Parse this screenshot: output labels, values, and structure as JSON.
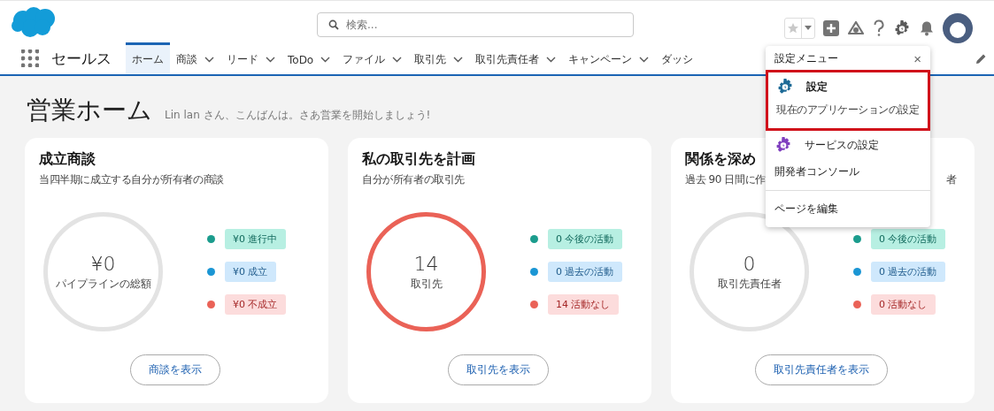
{
  "header": {
    "search": {
      "placeholder": "検索..."
    }
  },
  "nav": {
    "app_name": "セールス",
    "tabs": [
      {
        "label": "ホーム",
        "selected": true,
        "has_menu": false
      },
      {
        "label": "商談",
        "selected": false,
        "has_menu": true
      },
      {
        "label": "リード",
        "selected": false,
        "has_menu": true
      },
      {
        "label": "ToDo",
        "selected": false,
        "has_menu": true
      },
      {
        "label": "ファイル",
        "selected": false,
        "has_menu": true
      },
      {
        "label": "取引先",
        "selected": false,
        "has_menu": true
      },
      {
        "label": "取引先責任者",
        "selected": false,
        "has_menu": true
      },
      {
        "label": "キャンペーン",
        "selected": false,
        "has_menu": true
      },
      {
        "label": "ダッシ",
        "selected": false,
        "has_menu": false
      }
    ]
  },
  "page": {
    "title": "営業ホーム",
    "greeting": "Lin lan さん、こんばんは。さあ営業を開始しましょう!"
  },
  "cards": [
    {
      "title": "成立商談",
      "subtitle": [
        "当四半期に成立する自分が所有者の商談"
      ],
      "ring": {
        "value": "¥0",
        "label": "パイプラインの総額",
        "color": "#e3e3e3"
      },
      "legend": [
        {
          "label": "¥0 進行中",
          "color": "#1b9c8d"
        },
        {
          "label": "¥0 成立",
          "color": "#1b96d4"
        },
        {
          "label": "¥0 不成立",
          "color": "#ea6257"
        }
      ],
      "button": "商談を表示"
    },
    {
      "title": "私の取引先を計画",
      "subtitle": [
        "自分が所有者の取引先"
      ],
      "ring": {
        "value": "14",
        "label": "取引先",
        "color": "#ea6257"
      },
      "legend": [
        {
          "label": "0 今後の活動",
          "color": "#1b9c8d"
        },
        {
          "label": "0 過去の活動",
          "color": "#1b96d4"
        },
        {
          "label": "14 活動なし",
          "color": "#ea6257"
        }
      ],
      "button": "取引先を表示"
    },
    {
      "title": "関係を深め",
      "subtitle": [
        "過去 90 日間に作",
        "者"
      ],
      "ring": {
        "value": "0",
        "label": "取引先責任者",
        "color": "#e3e3e3"
      },
      "legend": [
        {
          "label": "0 今後の活動",
          "color": "#1b9c8d"
        },
        {
          "label": "0 過去の活動",
          "color": "#1b96d4"
        },
        {
          "label": "0 活動なし",
          "color": "#ea6257"
        }
      ],
      "button": "取引先責任者を表示"
    }
  ],
  "setup_menu": {
    "title": "設定メニュー",
    "close": "×",
    "items": [
      {
        "kind": "setup",
        "label": "設定",
        "description": "現在のアプリケーションの設定",
        "highlighted": true
      },
      {
        "kind": "service",
        "label": "サービスの設定",
        "highlighted": false
      },
      {
        "kind": "plain",
        "label": "開発者コンソール",
        "highlighted": false
      },
      {
        "kind": "divider"
      },
      {
        "kind": "plain",
        "label": "ページを編集",
        "highlighted": false
      }
    ]
  }
}
